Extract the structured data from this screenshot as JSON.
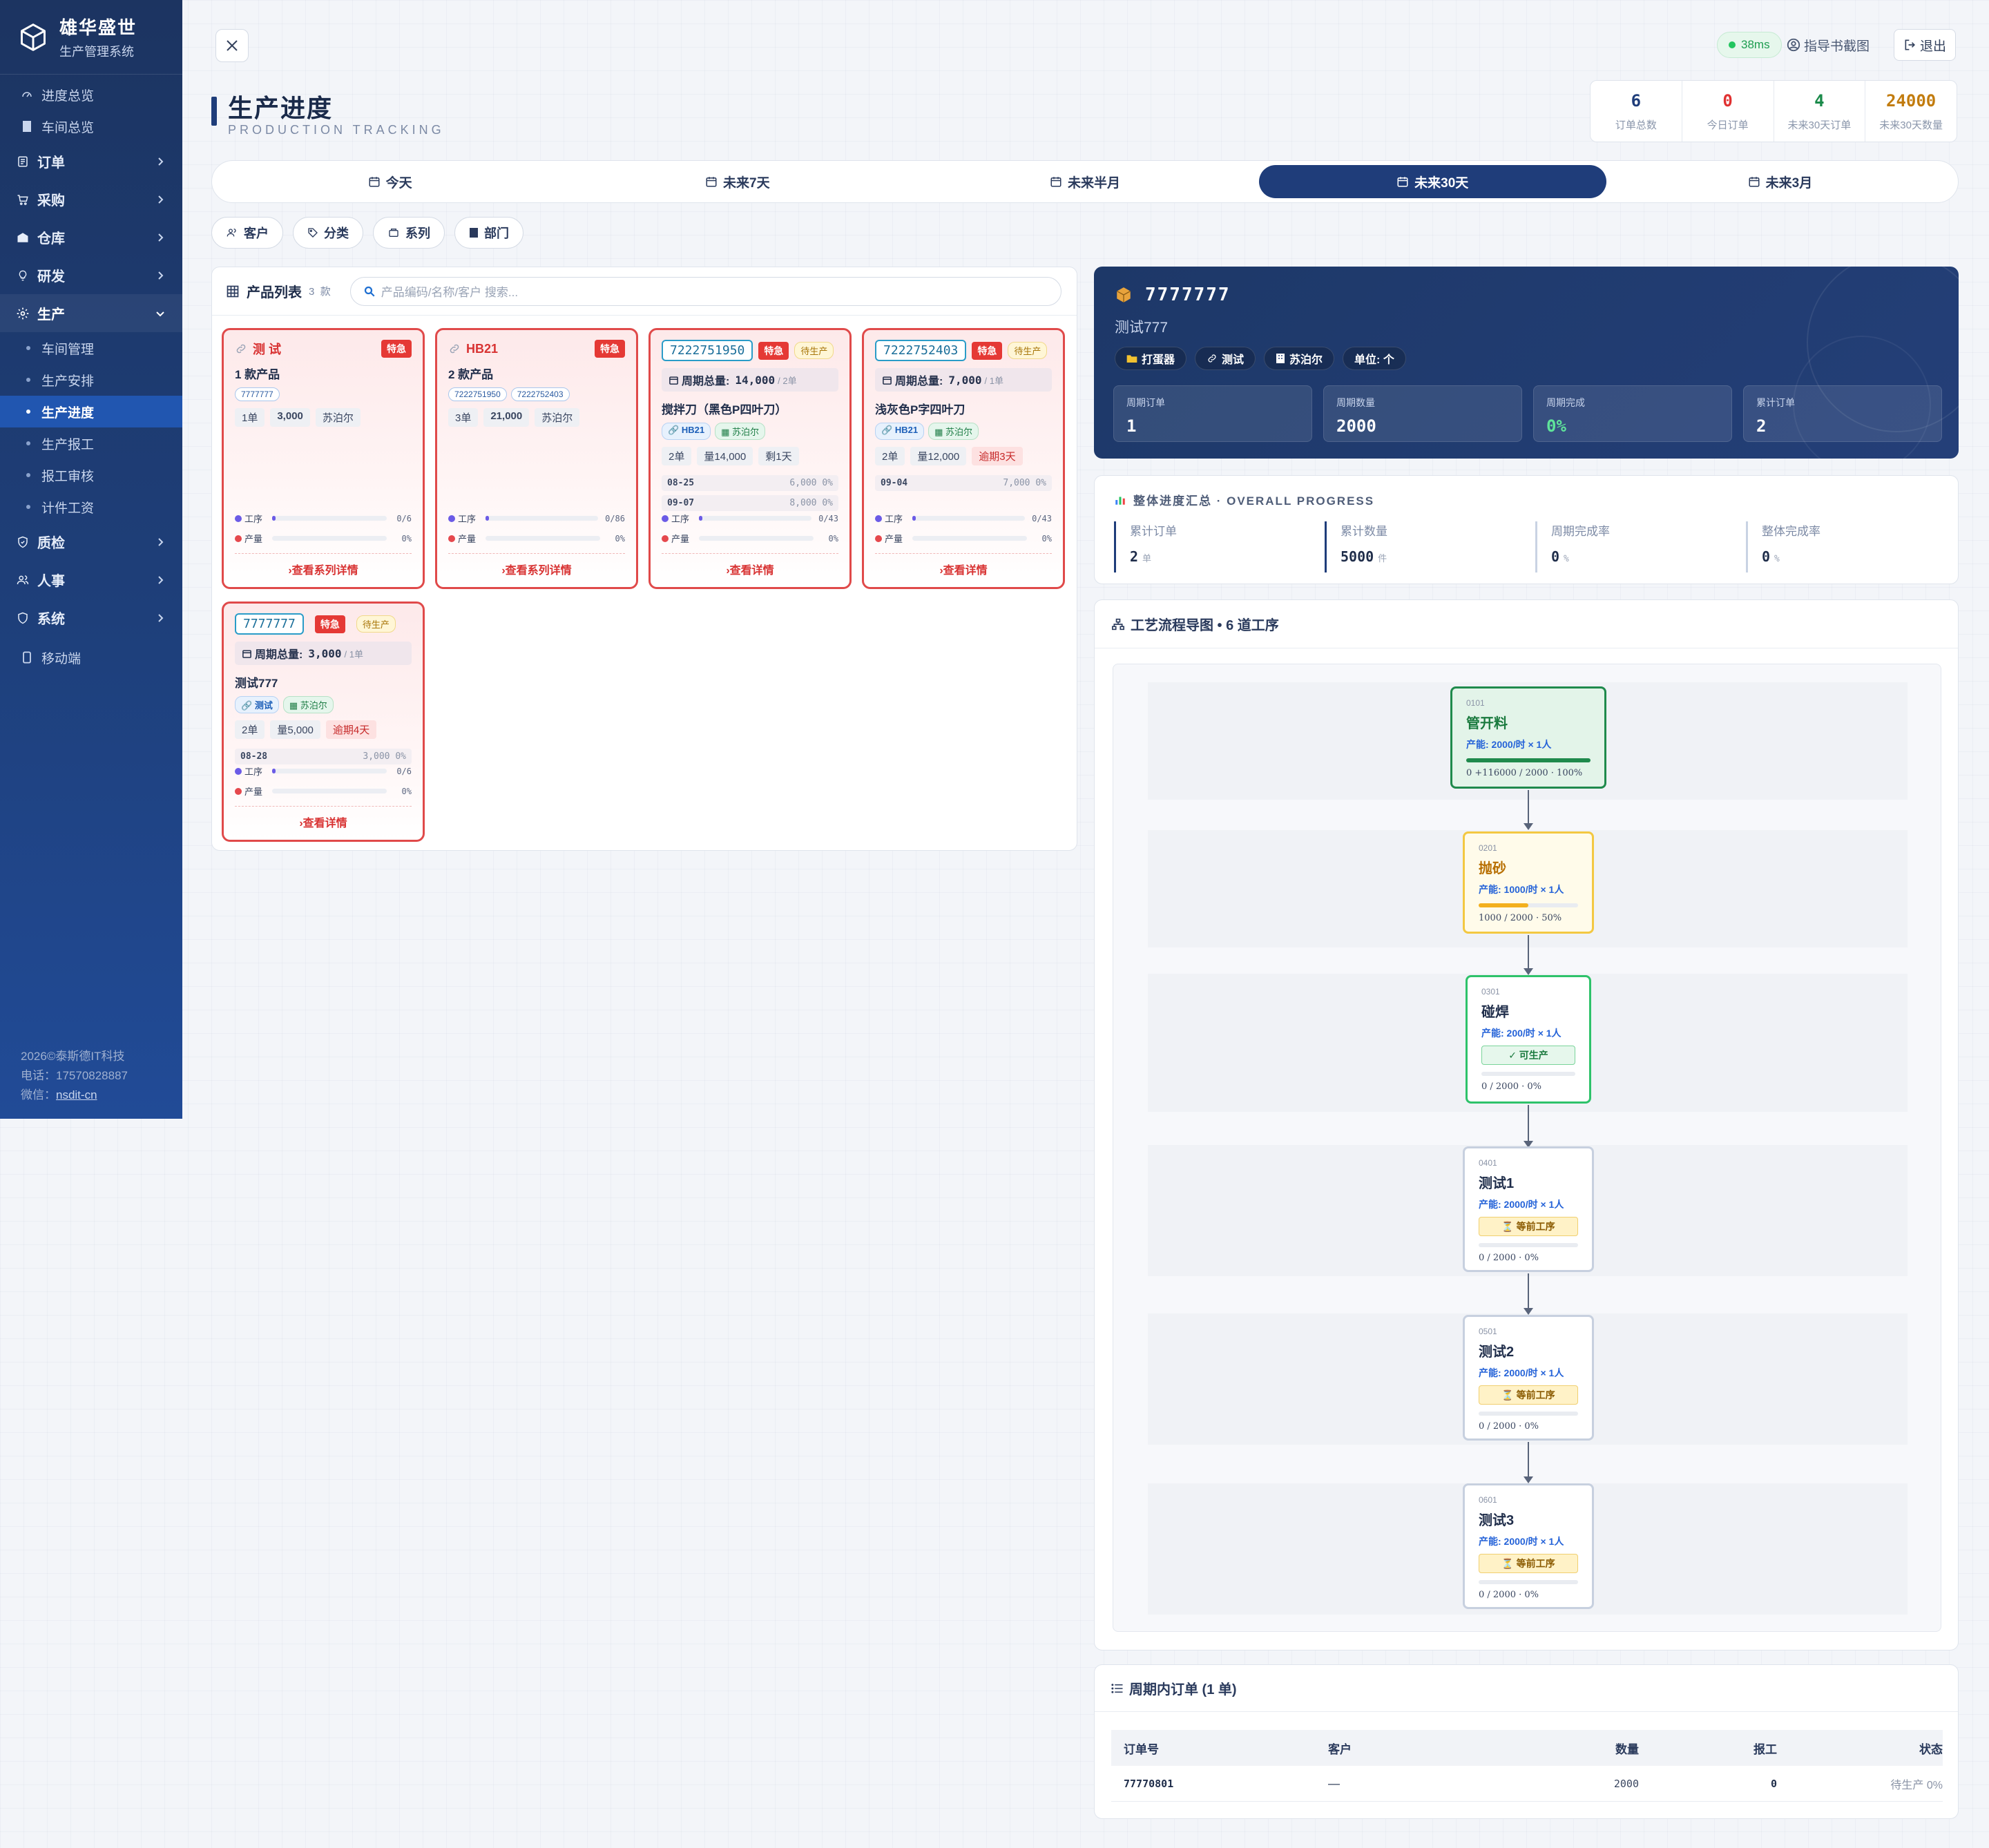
{
  "app": {
    "name": "雄华盛世",
    "subtitle": "生产管理系统"
  },
  "nav": {
    "top_links": [
      {
        "label": "进度总览"
      },
      {
        "label": "车间总览"
      }
    ],
    "groups": [
      {
        "label": "订单"
      },
      {
        "label": "采购"
      },
      {
        "label": "仓库"
      },
      {
        "label": "研发"
      }
    ],
    "production": {
      "label": "生产",
      "children": [
        "车间管理",
        "生产安排",
        "生产进度",
        "生产报工",
        "报工审核",
        "计件工资"
      ],
      "active": "生产进度"
    },
    "groups_after": [
      {
        "label": "质检"
      },
      {
        "label": "人事"
      },
      {
        "label": "系统"
      }
    ],
    "mobile": "移动端"
  },
  "footer": {
    "company": "2026©泰斯德IT科技",
    "phone": "电话：17570828887",
    "wechat_label": "微信：",
    "wechat": "nsdit-cn"
  },
  "header": {
    "ping": "38ms",
    "guide": "指导书截图",
    "logout": "退出",
    "title": "生产进度",
    "subtitle": "PRODUCTION TRACKING"
  },
  "stats": [
    {
      "value": "6",
      "label": "订单总数",
      "color": "#1f3d7a"
    },
    {
      "value": "0",
      "label": "今日订单",
      "color": "#e03131"
    },
    {
      "value": "4",
      "label": "未来30天订单",
      "color": "#1a8a4a"
    },
    {
      "value": "24000",
      "label": "未来30天数量",
      "color": "#c27c0e"
    }
  ],
  "range_tabs": [
    "今天",
    "未来7天",
    "未来半月",
    "未来30天",
    "未来3月"
  ],
  "range_active": "未来30天",
  "filters": [
    "客户",
    "分类",
    "系列",
    "部门"
  ],
  "product_list": {
    "title": "产品列表",
    "count": "3",
    "count_unit": "款",
    "search_placeholder": "产品编码/名称/客户 搜索..."
  },
  "series_cards": [
    {
      "name": "测 试",
      "tag": "特急",
      "count": "1 款产品",
      "codes": [
        "7777777"
      ],
      "orders": "1单",
      "qty": "3,000",
      "customer": "苏泊尔",
      "proc": "0/6",
      "prod": "0%",
      "link": "查看系列详情"
    },
    {
      "name": "HB21",
      "tag": "特急",
      "count": "2 款产品",
      "codes": [
        "7222751950",
        "7222752403"
      ],
      "orders": "3单",
      "qty": "21,000",
      "customer": "苏泊尔",
      "proc": "0/86",
      "prod": "0%",
      "link": "查看系列详情"
    }
  ],
  "product_cards": [
    {
      "code": "7222751950",
      "tag": "特急",
      "status": "待生产",
      "total_label": "周期总量:",
      "total": "14,000",
      "total_unit": "/ 2单",
      "title": "搅拌刀（黑色P四叶刀）",
      "series": "HB21",
      "customer": "苏泊尔",
      "orders": "2单",
      "qty": "量14,000",
      "remain": "剩1天",
      "dates": [
        {
          "d": "08-25",
          "v": "6,000 0%"
        },
        {
          "d": "09-07",
          "v": "8,000 0%"
        }
      ],
      "proc": "0/43",
      "prod": "0%",
      "link": "查看详情"
    },
    {
      "code": "7222752403",
      "tag": "特急",
      "status": "待生产",
      "total_label": "周期总量:",
      "total": "7,000",
      "total_unit": "/ 1单",
      "title": "浅灰色P字四叶刀",
      "series": "HB21",
      "customer": "苏泊尔",
      "orders": "2单",
      "qty": "量12,000",
      "remain": "逾期3天",
      "dates": [
        {
          "d": "09-04",
          "v": "7,000 0%"
        }
      ],
      "proc": "0/43",
      "prod": "0%",
      "link": "查看详情"
    },
    {
      "code": "7777777",
      "tag": "特急",
      "status": "待生产",
      "total_label": "周期总量:",
      "total": "3,000",
      "total_unit": "/ 1单",
      "title": "测试777",
      "series": "测试",
      "customer": "苏泊尔",
      "orders": "2单",
      "qty": "量5,000",
      "remain": "逾期4天",
      "dates": [
        {
          "d": "08-28",
          "v": "3,000 0%"
        }
      ],
      "proc": "0/6",
      "prod": "0%",
      "link": "查看详情"
    }
  ],
  "labels": {
    "proc": "工序",
    "prod": "产量"
  },
  "detail": {
    "code": "7777777",
    "name": "测试777",
    "tags": [
      "打蛋器",
      "测试",
      "苏泊尔",
      "单位: 个"
    ],
    "boxes": [
      {
        "label": "周期订单",
        "value": "1"
      },
      {
        "label": "周期数量",
        "value": "2000"
      },
      {
        "label": "周期完成",
        "value": "0%"
      },
      {
        "label": "累计订单",
        "value": "2"
      }
    ]
  },
  "overall": {
    "title": "整体进度汇总 · OVERALL PROGRESS",
    "cells": [
      {
        "label": "累计订单",
        "value": "2",
        "unit": "单"
      },
      {
        "label": "累计数量",
        "value": "5000",
        "unit": "件"
      },
      {
        "label": "周期完成率",
        "value": "0",
        "unit": "%"
      },
      {
        "label": "整体完成率",
        "value": "0",
        "unit": "%"
      }
    ]
  },
  "flow": {
    "title": "工艺流程导图 • 6 道工序",
    "nodes": [
      {
        "code": "0101",
        "name": "管开料",
        "cap": "产能: 2000/时 × 1人",
        "value": "0 +116000  /  2000  ·  100%",
        "progress": 1.0
      },
      {
        "code": "0201",
        "name": "抛砂",
        "cap": "产能: 1000/时 × 1人",
        "value": "1000  /  2000  ·  50%",
        "progress": 0.5
      },
      {
        "code": "0301",
        "name": "碰焊",
        "cap": "产能: 200/时 × 1人",
        "badge": "✓ 可生产",
        "value": "0  /  2000  ·  0%",
        "progress": 0
      },
      {
        "code": "0401",
        "name": "测试1",
        "cap": "产能: 2000/时 × 1人",
        "badge": "⏳ 等前工序",
        "value": "0  /  2000  ·  0%",
        "progress": 0
      },
      {
        "code": "0501",
        "name": "测试2",
        "cap": "产能: 2000/时 × 1人",
        "badge": "⏳ 等前工序",
        "value": "0  /  2000  ·  0%",
        "progress": 0
      },
      {
        "code": "0601",
        "name": "测试3",
        "cap": "产能: 2000/时 × 1人",
        "badge": "⏳ 等前工序",
        "value": "0  /  2000  ·  0%",
        "progress": 0
      }
    ]
  },
  "orders": {
    "title": "周期内订单 (1 单)",
    "columns": [
      "订单号",
      "客户",
      "数量",
      "报工",
      "状态"
    ],
    "rows": [
      {
        "no": "77770801",
        "customer": "—",
        "qty": "2000",
        "report": "0",
        "status": "待生产 0%"
      }
    ]
  }
}
